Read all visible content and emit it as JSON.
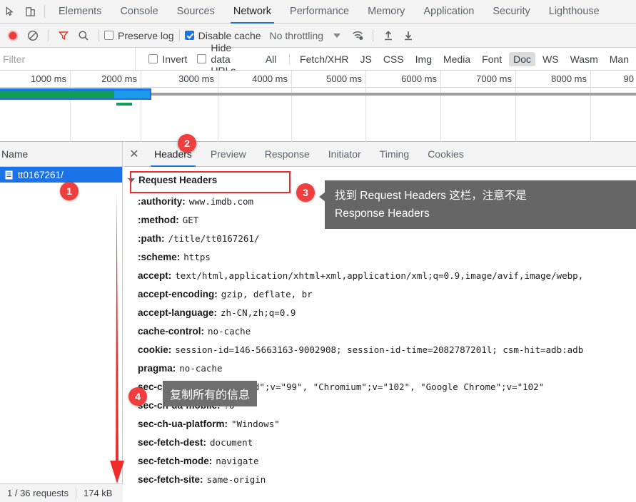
{
  "devtools": {
    "icons": {
      "inspect": "inspect-element-icon",
      "device": "device-toolbar-icon"
    },
    "tabs": [
      {
        "label": "Elements",
        "active": false
      },
      {
        "label": "Console",
        "active": false
      },
      {
        "label": "Sources",
        "active": false
      },
      {
        "label": "Network",
        "active": true
      },
      {
        "label": "Performance",
        "active": false
      },
      {
        "label": "Memory",
        "active": false
      },
      {
        "label": "Application",
        "active": false
      },
      {
        "label": "Security",
        "active": false
      },
      {
        "label": "Lighthouse",
        "active": false
      }
    ]
  },
  "network_toolbar": {
    "record_icon": "record-button-icon",
    "clear_icon": "clear-icon",
    "filter_icon": "filter-funnel-icon",
    "search_icon": "search-icon",
    "preserve_log_label": "Preserve log",
    "preserve_log_checked": false,
    "disable_cache_label": "Disable cache",
    "disable_cache_checked": true,
    "throttling_label": "No throttling",
    "wifi_icon": "wifi-settings-icon",
    "import_icon": "import-har-icon",
    "export_icon": "export-har-icon"
  },
  "filter_bar": {
    "placeholder": "Filter",
    "value": "",
    "invert_label": "Invert",
    "invert_checked": false,
    "hide_data_urls_label": "Hide data URLs",
    "hide_data_urls_checked": false,
    "types": [
      {
        "label": "All",
        "selected": false
      },
      {
        "label": "Fetch/XHR",
        "selected": false
      },
      {
        "label": "JS",
        "selected": false
      },
      {
        "label": "CSS",
        "selected": false
      },
      {
        "label": "Img",
        "selected": false
      },
      {
        "label": "Media",
        "selected": false
      },
      {
        "label": "Font",
        "selected": false
      },
      {
        "label": "Doc",
        "selected": true
      },
      {
        "label": "WS",
        "selected": false
      },
      {
        "label": "Wasm",
        "selected": false
      },
      {
        "label": "Man",
        "selected": false
      }
    ]
  },
  "overview": {
    "ticks": [
      "1000 ms",
      "2000 ms",
      "3000 ms",
      "4000 ms",
      "5000 ms",
      "6000 ms",
      "7000 ms",
      "8000 ms",
      "90"
    ]
  },
  "requests_panel": {
    "column_header": "Name",
    "rows": [
      {
        "name": "tt0167261/",
        "icon": "document-icon",
        "selected": true
      }
    ],
    "status": {
      "requests": "1 / 36 requests",
      "transferred": "174 kB"
    }
  },
  "details_panel": {
    "close_icon": "close-icon",
    "tabs": [
      {
        "label": "Headers",
        "active": true
      },
      {
        "label": "Preview",
        "active": false
      },
      {
        "label": "Response",
        "active": false
      },
      {
        "label": "Initiator",
        "active": false
      },
      {
        "label": "Timing",
        "active": false
      },
      {
        "label": "Cookies",
        "active": false
      }
    ],
    "section_title": "Request Headers",
    "headers": [
      {
        "name": ":authority:",
        "value": "www.imdb.com"
      },
      {
        "name": ":method:",
        "value": "GET"
      },
      {
        "name": ":path:",
        "value": "/title/tt0167261/"
      },
      {
        "name": ":scheme:",
        "value": "https"
      },
      {
        "name": "accept:",
        "value": "text/html,application/xhtml+xml,application/xml;q=0.9,image/avif,image/webp,"
      },
      {
        "name": "accept-encoding:",
        "value": "gzip, deflate, br"
      },
      {
        "name": "accept-language:",
        "value": "zh-CN,zh;q=0.9"
      },
      {
        "name": "cache-control:",
        "value": "no-cache"
      },
      {
        "name": "cookie:",
        "value": "session-id=146-5663163-9002908; session-id-time=2082787201l; csm-hit=adb:adb"
      },
      {
        "name": "pragma:",
        "value": "no-cache"
      },
      {
        "name": "sec-ch-ua:",
        "value": "\" Not A;Brand\";v=\"99\", \"Chromium\";v=\"102\", \"Google Chrome\";v=\"102\""
      },
      {
        "name": "sec-ch-ua-mobile:",
        "value": "?0"
      },
      {
        "name": "sec-ch-ua-platform:",
        "value": "\"Windows\""
      },
      {
        "name": "sec-fetch-dest:",
        "value": "document"
      },
      {
        "name": "sec-fetch-mode:",
        "value": "navigate"
      },
      {
        "name": "sec-fetch-site:",
        "value": "same-origin"
      }
    ]
  },
  "annotations": {
    "badges": [
      {
        "number": "1"
      },
      {
        "number": "2"
      },
      {
        "number": "3"
      },
      {
        "number": "4"
      }
    ],
    "tooltip_main": "找到 Request Headers 这栏，注意不是\nResponse Headers",
    "tooltip_copy": "复制所有的信息",
    "accent_red": "#f02b2b",
    "arrow_icon": "down-arrow-annotation-icon"
  }
}
